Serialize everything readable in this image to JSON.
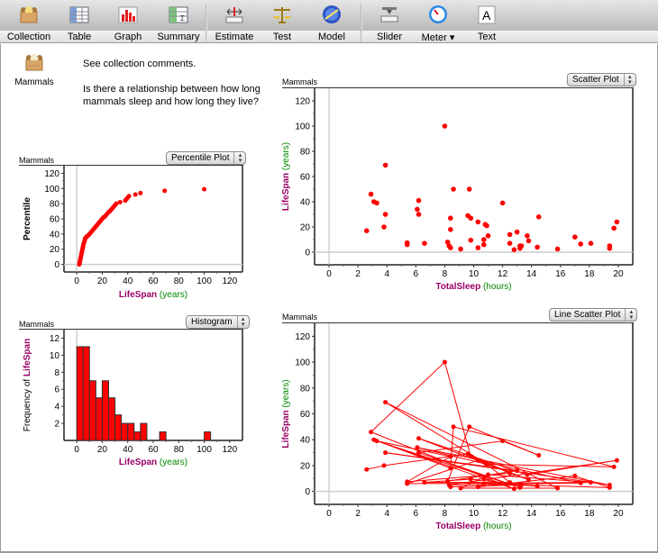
{
  "toolbar": {
    "items": [
      {
        "label": "Collection",
        "icon": "collection-icon"
      },
      {
        "label": "Table",
        "icon": "table-icon"
      },
      {
        "label": "Graph",
        "icon": "graph-icon"
      },
      {
        "label": "Summary",
        "icon": "summary-icon"
      },
      {
        "label": "Estimate",
        "icon": "estimate-icon"
      },
      {
        "label": "Test",
        "icon": "scales-icon"
      },
      {
        "label": "Model",
        "icon": "model-icon"
      },
      {
        "label": "Slider",
        "icon": "slider-icon"
      },
      {
        "label": "Meter ▾",
        "icon": "meter-icon"
      },
      {
        "label": "Text",
        "icon": "text-icon"
      }
    ]
  },
  "collection": {
    "name": "Mammals"
  },
  "text_box": {
    "line1": "See collection comments.",
    "line2": "Is there a relationship between how long mammals sleep and how long they live?"
  },
  "colors": {
    "point": "#ff0000",
    "attr_name": "#990066",
    "unit": "#008800"
  },
  "graphs": {
    "percentile": {
      "collection": "Mammals",
      "plot_type": "Percentile Plot",
      "x_attr": "LifeSpan",
      "x_unit": "(years)",
      "y_label": "Percentile"
    },
    "histogram": {
      "collection": "Mammals",
      "plot_type": "Histogram",
      "x_attr": "LifeSpan",
      "x_unit": "(years)",
      "y_prefix": "Frequency of ",
      "y_attr": "LifeSpan"
    },
    "scatter": {
      "collection": "Mammals",
      "plot_type": "Scatter Plot",
      "x_attr": "TotalSleep",
      "x_unit": "(hours)",
      "y_attr": "LifeSpan",
      "y_unit": "(years)"
    },
    "line_scatter": {
      "collection": "Mammals",
      "plot_type": "Line Scatter Plot",
      "x_attr": "TotalSleep",
      "x_unit": "(hours)",
      "y_attr": "LifeSpan",
      "y_unit": "(years)"
    }
  },
  "chart_data": [
    {
      "id": "percentile",
      "type": "scatter",
      "title": "",
      "xlabel": "LifeSpan (years)",
      "ylabel": "Percentile",
      "xlim": [
        -10,
        130
      ],
      "ylim": [
        -10,
        130
      ],
      "xticks": [
        0,
        20,
        40,
        60,
        80,
        100,
        120
      ],
      "yticks": [
        0,
        20,
        40,
        60,
        80,
        100,
        120
      ],
      "x": [
        2,
        2.3,
        2.5,
        2.7,
        3,
        3.2,
        3.5,
        3.7,
        4,
        4.2,
        4.5,
        4.7,
        5,
        5.2,
        5.5,
        6,
        6.3,
        6.5,
        7,
        7.5,
        8,
        9,
        10,
        11,
        12,
        13,
        14,
        15,
        16,
        17,
        18,
        19,
        20,
        21,
        22,
        23,
        24,
        25,
        26,
        27,
        28,
        29,
        30,
        31,
        34,
        38,
        39,
        40,
        41,
        46,
        50,
        69,
        100
      ],
      "y": [
        0,
        2,
        4,
        6,
        8,
        10,
        12,
        14,
        16,
        18,
        20,
        22,
        24,
        26,
        28,
        30,
        32,
        34,
        35,
        36,
        37,
        38,
        40,
        42,
        44,
        46,
        48,
        50,
        52,
        54,
        56,
        58,
        60,
        62,
        63,
        65,
        67,
        69,
        70,
        72,
        74,
        76,
        78,
        80,
        82,
        84,
        86,
        88,
        90,
        92,
        94,
        97,
        99
      ],
      "grid": false,
      "legend": "none"
    },
    {
      "id": "histogram",
      "type": "bar",
      "title": "",
      "xlabel": "LifeSpan (years)",
      "ylabel": "Frequency of LifeSpan",
      "bin_width": 5,
      "bin_starts": [
        0,
        5,
        10,
        15,
        20,
        25,
        30,
        35,
        40,
        45,
        50,
        65,
        100
      ],
      "values": [
        11,
        11,
        7,
        5,
        7,
        5,
        3,
        2,
        2,
        1,
        2,
        1,
        1
      ],
      "xlim": [
        -10,
        130
      ],
      "ylim": [
        0,
        13
      ],
      "xticks": [
        0,
        20,
        40,
        60,
        80,
        100,
        120
      ],
      "yticks": [
        2,
        4,
        6,
        8,
        10,
        12
      ],
      "grid": false,
      "legend": "none"
    },
    {
      "id": "scatter",
      "type": "scatter",
      "title": "",
      "xlabel": "TotalSleep (hours)",
      "ylabel": "LifeSpan (years)",
      "xlim": [
        -1,
        21
      ],
      "ylim": [
        -10,
        130
      ],
      "xticks": [
        0,
        2,
        4,
        6,
        8,
        10,
        12,
        14,
        16,
        18,
        20
      ],
      "yticks": [
        0,
        20,
        40,
        60,
        80,
        100,
        120
      ],
      "x": [
        8.0,
        3.9,
        2.9,
        3.1,
        3.3,
        3.9,
        3.8,
        2.6,
        8.6,
        9.7,
        6.2,
        6.1,
        6.2,
        5.4,
        5.4,
        6.6,
        8.4,
        8.4,
        8.2,
        8.3,
        8.4,
        9.1,
        9.6,
        9.8,
        9.8,
        10.3,
        10.3,
        10.7,
        10.7,
        10.8,
        10.9,
        11.0,
        12.0,
        12.5,
        12.5,
        12.8,
        13.0,
        13.2,
        13.2,
        13.3,
        13.7,
        13.8,
        14.4,
        14.5,
        15.8,
        17.0,
        17.4,
        18.1,
        19.4,
        19.4,
        19.7,
        19.9
      ],
      "y": [
        100,
        69,
        46,
        40,
        39,
        30,
        20,
        17,
        50,
        50,
        41,
        34,
        30,
        7.5,
        6,
        7,
        27,
        18,
        8,
        5,
        3.5,
        2.5,
        29,
        27,
        9.5,
        24,
        3.5,
        10,
        6,
        22,
        21,
        13,
        39,
        14,
        7,
        2,
        16,
        3,
        5,
        5,
        13,
        9,
        4,
        28,
        2.5,
        12,
        6.5,
        7,
        5,
        3,
        19,
        24
      ],
      "grid": false,
      "legend": "none"
    },
    {
      "id": "line_scatter",
      "type": "line",
      "title": "",
      "xlabel": "TotalSleep (hours)",
      "ylabel": "LifeSpan (years)",
      "xlim": [
        -1,
        21
      ],
      "ylim": [
        -10,
        130
      ],
      "xticks": [
        0,
        2,
        4,
        6,
        8,
        10,
        12,
        14,
        16,
        18,
        20
      ],
      "yticks": [
        0,
        20,
        40,
        60,
        80,
        100,
        120
      ],
      "x": [
        2.6,
        3.8,
        9.6,
        12.5,
        5.4,
        8.4,
        3.3,
        13.2,
        6.2,
        12.0,
        14.5,
        9.7,
        8.2,
        13.0,
        3.9,
        19.4,
        6.1,
        10.9,
        19.7,
        8.6,
        8.4,
        3.1,
        10.7,
        12.8,
        2.9,
        8.0,
        9.8,
        13.8,
        6.2,
        13.7,
        19.9,
        8.3,
        17.4,
        10.3,
        5.4,
        18.1,
        11.0,
        9.1,
        15.8,
        3.9,
        10.8,
        12.5,
        6.6,
        9.8,
        14.4,
        13.3,
        19.4,
        17.0,
        10.3,
        10.7,
        13.2,
        8.4
      ],
      "y": [
        17,
        20,
        29,
        14,
        7.5,
        27,
        39,
        3,
        30,
        39,
        28,
        50,
        8,
        16,
        30,
        5,
        34,
        21,
        19,
        50,
        18,
        40,
        10,
        2,
        46,
        100,
        27,
        9,
        41,
        13,
        24,
        5,
        6.5,
        24,
        6,
        7,
        13,
        2.5,
        2.5,
        69,
        22,
        7,
        7,
        9.5,
        4,
        5,
        3,
        12,
        3.5,
        6,
        5,
        3.5
      ],
      "grid": false,
      "legend": "none"
    }
  ]
}
